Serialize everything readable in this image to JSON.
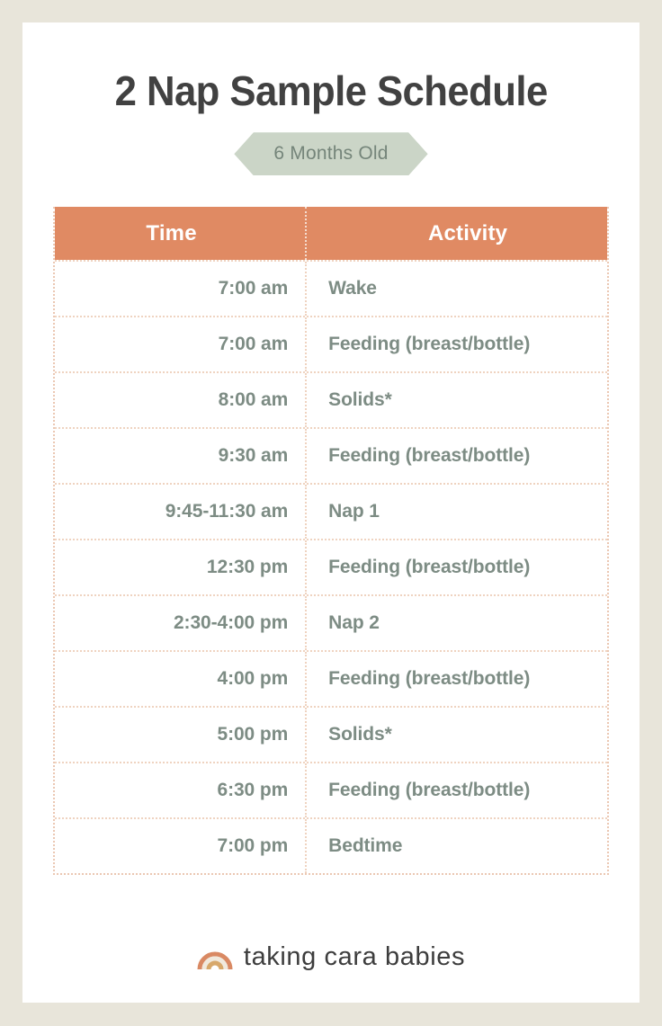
{
  "header": {
    "title": "2 Nap Sample Schedule",
    "badge": "6 Months Old"
  },
  "table": {
    "columns": [
      "Time",
      "Activity"
    ],
    "rows": [
      {
        "time": "7:00 am",
        "activity": "Wake"
      },
      {
        "time": "7:00 am",
        "activity": "Feeding (breast/bottle)"
      },
      {
        "time": "8:00 am",
        "activity": "Solids*"
      },
      {
        "time": "9:30 am",
        "activity": "Feeding (breast/bottle)"
      },
      {
        "time": "9:45-11:30 am",
        "activity": "Nap 1"
      },
      {
        "time": "12:30 pm",
        "activity": "Feeding (breast/bottle)"
      },
      {
        "time": "2:30-4:00 pm",
        "activity": "Nap 2"
      },
      {
        "time": "4:00 pm",
        "activity": "Feeding (breast/bottle)"
      },
      {
        "time": "5:00 pm",
        "activity": "Solids*"
      },
      {
        "time": "6:30 pm",
        "activity": "Feeding (breast/bottle)"
      },
      {
        "time": "7:00 pm",
        "activity": "Bedtime"
      }
    ]
  },
  "footer": {
    "brand": "taking cara babies",
    "logo_icon": "rainbow-icon"
  },
  "colors": {
    "frame": "#E8E5DA",
    "card": "#FFFFFF",
    "accent_salmon": "#E08A63",
    "badge_green": "#CBD5C7",
    "badge_text": "#75857A",
    "body_text": "#7D8C84",
    "title_text": "#414141",
    "border_dotted": "#EFD3C0",
    "rainbow_outer": "#D98963",
    "rainbow_middle": "#F3EDE4",
    "rainbow_inner": "#D4A574"
  }
}
